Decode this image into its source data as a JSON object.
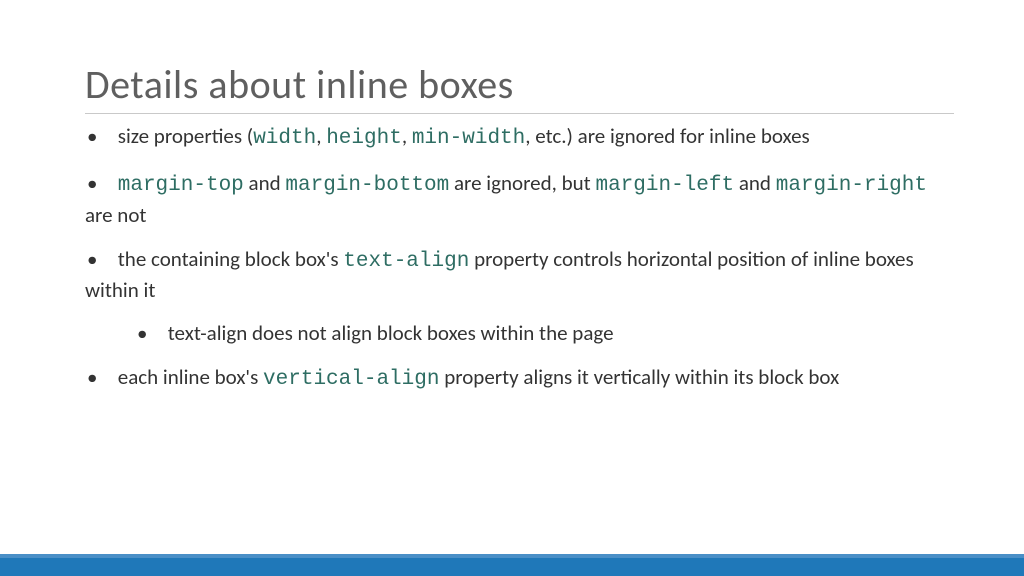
{
  "title": "Details about inline boxes",
  "bullets": {
    "b1": {
      "t1": "size properties (",
      "c1": "width",
      "t2": ", ",
      "c2": "height",
      "t3": ", ",
      "c3": "min-width",
      "t4": ", etc.) are ignored for inline boxes"
    },
    "b2": {
      "t1": " ",
      "c1": "margin-top",
      "t2": " and ",
      "c2": "margin-bottom",
      "t3": " are ignored, but ",
      "c3": "margin-left",
      "t4": " and ",
      "c4": "margin-right",
      "t5": " are not"
    },
    "b3": {
      "t1": "the containing block box's ",
      "c1": "text-align",
      "t2": " property controls horizontal position of inline boxes within it",
      "sub1": "text-align does not align block boxes within the page"
    },
    "b4": {
      "t1": "each inline box's ",
      "c1": "vertical-align",
      "t2": " property aligns it vertically within its block box"
    }
  }
}
